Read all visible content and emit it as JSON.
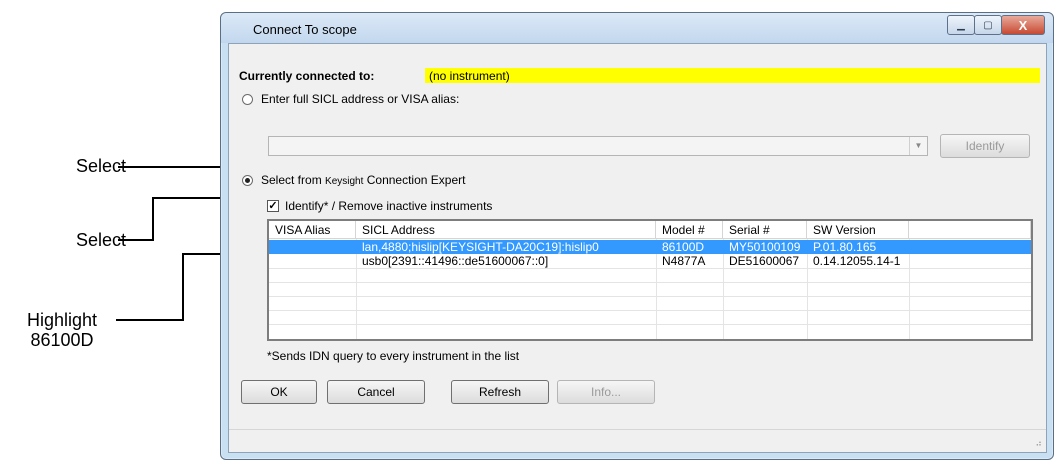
{
  "callouts": {
    "select1": "Select",
    "select2": "Select",
    "highlight_line1": "Highlight",
    "highlight_line2": "86100D"
  },
  "window": {
    "title": "Connect To scope",
    "minimize_glyph": "▁",
    "maximize_glyph": "▢",
    "close_glyph": "X"
  },
  "connection": {
    "label": "Currently connected to:",
    "value": "(no instrument)",
    "highlight_color": "#ffff00"
  },
  "options": {
    "sicl_radio_label": "Enter full SICL address or VISA alias:",
    "sicl_radio_checked": false,
    "address_value": "",
    "identify_button": "Identify",
    "expert_radio_prefix": "Select from ",
    "expert_radio_brand": "Keysight",
    "expert_radio_suffix": " Connection Expert",
    "expert_radio_checked": true,
    "identify_checkbox_label": "Identify* / Remove inactive instruments",
    "identify_checkbox_checked": true,
    "checkbox_mark": "✓"
  },
  "instrument_list": {
    "columns": [
      "VISA Alias",
      "SICL Address",
      "Model #",
      "Serial #",
      "SW Version"
    ],
    "rows": [
      {
        "alias": "",
        "sicl": "lan,4880;hislip[KEYSIGHT-DA20C19]:hislip0",
        "model": "86100D",
        "serial": "MY50100109",
        "sw": "P.01.80.165",
        "selected": true
      },
      {
        "alias": "",
        "sicl": "usb0[2391::41496::de51600067::0]",
        "model": "N4877A",
        "serial": "DE51600067",
        "sw": "0.14.12055.14-1",
        "selected": false
      }
    ],
    "selection_color": "#3399ff"
  },
  "footnote": "*Sends IDN query to every instrument in the list",
  "buttons": {
    "ok": "OK",
    "cancel": "Cancel",
    "refresh": "Refresh",
    "info": "Info..."
  },
  "size_grip": "⠴"
}
